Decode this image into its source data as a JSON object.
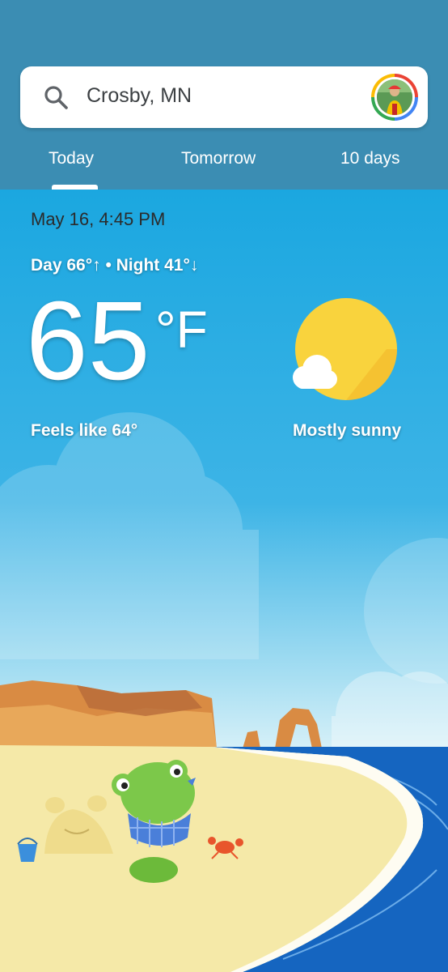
{
  "search": {
    "location": "Crosby, MN"
  },
  "tabs": [
    {
      "label": "Today",
      "selected": true
    },
    {
      "label": "Tomorrow",
      "selected": false
    },
    {
      "label": "10 days",
      "selected": false
    }
  ],
  "weather": {
    "datetime": "May 16, 4:45 PM",
    "day_night": "Day 66°↑ • Night 41°↓",
    "temperature": "65",
    "unit": "°F",
    "feels_like": "Feels like 64°",
    "condition": "Mostly sunny",
    "condition_icon": "sun-with-cloud-icon"
  },
  "colors": {
    "topbar": "#3b8db3",
    "sky": "#1ba7e0",
    "sun": "#f9d33d",
    "sea": "#1565c0",
    "sand": "#f5e9a8"
  }
}
